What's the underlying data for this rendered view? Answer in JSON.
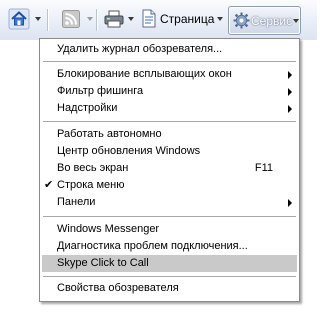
{
  "toolbar": {
    "page_label": "Страница",
    "tools_label": "Сервис"
  },
  "menu": {
    "groups": [
      {
        "items": [
          {
            "label": "Удалить журнал обозревателя..."
          }
        ]
      },
      {
        "items": [
          {
            "label": "Блокирование всплывающих окон",
            "submenu": true
          },
          {
            "label": "Фильтр фишинга",
            "submenu": true
          },
          {
            "label": "Надстройки",
            "submenu": true
          }
        ]
      },
      {
        "items": [
          {
            "label": "Работать автономно"
          },
          {
            "label": "Центр обновления Windows"
          },
          {
            "label": "Во весь экран",
            "shortcut": "F11"
          },
          {
            "label": "Строка меню",
            "checked": true
          },
          {
            "label": "Панели",
            "submenu": true
          }
        ]
      },
      {
        "items": [
          {
            "label": "Windows Messenger"
          },
          {
            "label": "Диагностика проблем подключения..."
          },
          {
            "label": "Skype Click to Call",
            "highlighted": true
          }
        ]
      },
      {
        "items": [
          {
            "label": "Свойства обозревателя"
          }
        ]
      }
    ]
  }
}
